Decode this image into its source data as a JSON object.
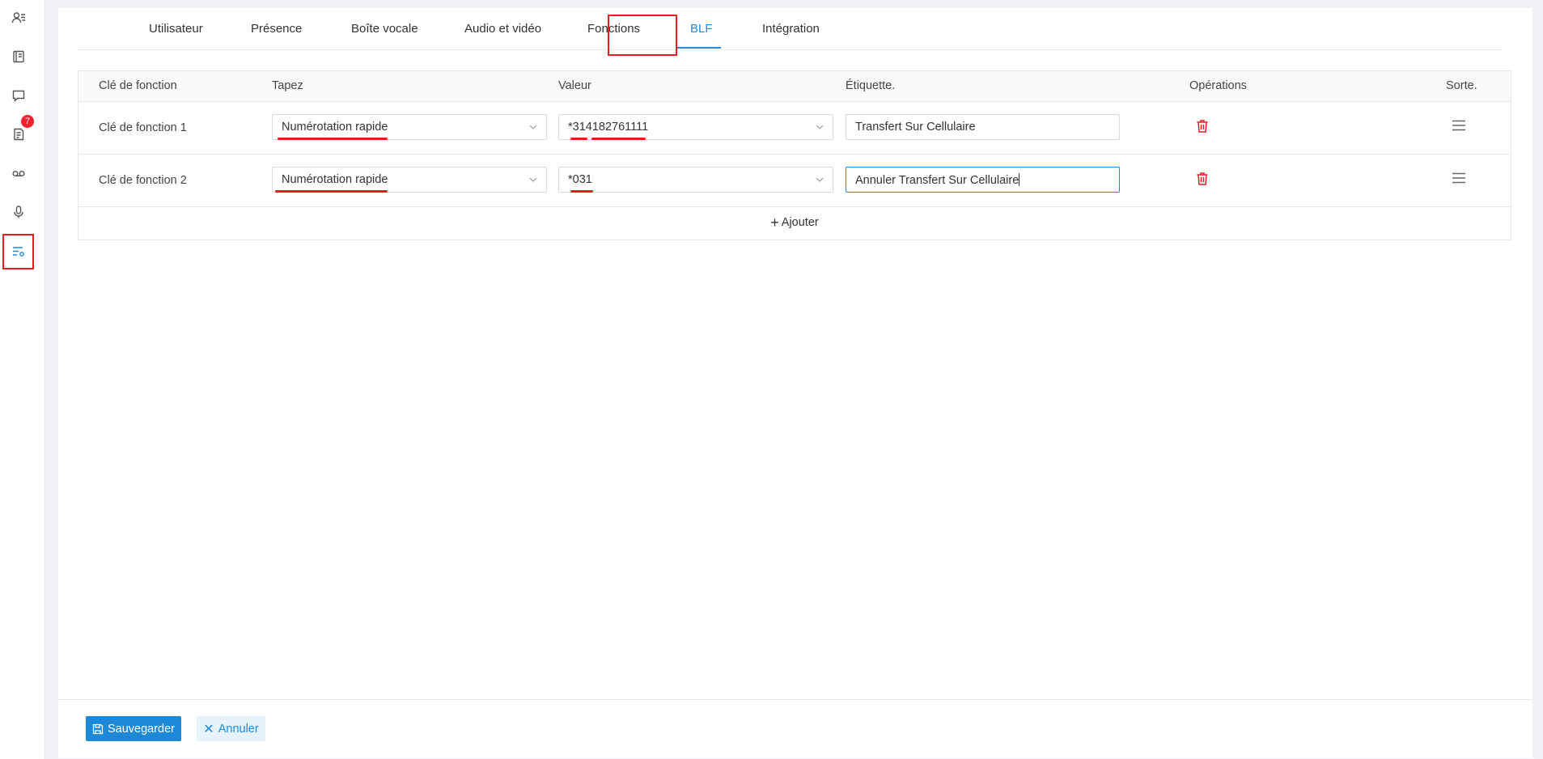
{
  "sidebar": {
    "items": [
      {
        "icon": "user-list-icon"
      },
      {
        "icon": "contacts-book-icon"
      },
      {
        "icon": "chat-icon"
      },
      {
        "icon": "call-log-icon",
        "badge": "7"
      },
      {
        "icon": "voicemail-icon"
      },
      {
        "icon": "microphone-icon"
      },
      {
        "icon": "settings-list-icon",
        "active": true
      }
    ]
  },
  "tabs": [
    {
      "label": "Utilisateur"
    },
    {
      "label": "Présence"
    },
    {
      "label": "Boîte vocale"
    },
    {
      "label": "Audio et vidéo"
    },
    {
      "label": "Fonctions"
    },
    {
      "label": "BLF",
      "active": true
    },
    {
      "label": "Intégration"
    }
  ],
  "table": {
    "headers": {
      "key": "Clé de fonction",
      "type": "Tapez",
      "value": "Valeur",
      "label": "Étiquette.",
      "operations": "Opérations",
      "sort": "Sorte."
    },
    "rows": [
      {
        "key": "Clé de fonction 1",
        "type": "Numérotation rapide",
        "value": "*314182761111",
        "label": "Transfert Sur Cellulaire"
      },
      {
        "key": "Clé de fonction 2",
        "type": "Numérotation rapide",
        "value": "*031",
        "label": "Annuler Transfert Sur Cellulaire"
      }
    ],
    "add_label": "Ajouter"
  },
  "footer": {
    "save_label": "Sauvegarder",
    "cancel_label": "Annuler"
  },
  "colors": {
    "accent": "#1e88d8",
    "danger": "#e81c1c",
    "annotation": "#e81c1c"
  }
}
